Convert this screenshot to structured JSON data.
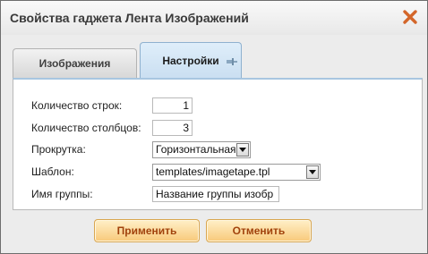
{
  "dialog": {
    "title": "Свойства гаджета Лента Изображений"
  },
  "tabs": [
    {
      "label": "Изображения",
      "active": false
    },
    {
      "label": "Настройки",
      "active": true
    }
  ],
  "form": {
    "rows_label": "Количество строк:",
    "rows_value": "1",
    "cols_label": "Количество столбцов:",
    "cols_value": "3",
    "scroll_label": "Прокрутка:",
    "scroll_value": "Горизонтальная",
    "template_label": "Шаблон:",
    "template_value": "templates/imagetape.tpl",
    "group_label": "Имя группы:",
    "group_value": "Название группы изобр"
  },
  "buttons": {
    "apply": "Применить",
    "cancel": "Отменить"
  },
  "colors": {
    "close_icon": "#d3662a",
    "button_text": "#a1420c",
    "active_tab": "#c9def1"
  },
  "icons": {
    "close": "close-icon",
    "pin": "pin-icon",
    "dropdown": "chevron-down-icon"
  }
}
